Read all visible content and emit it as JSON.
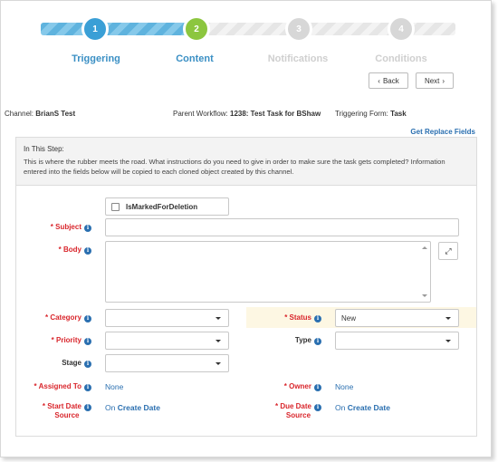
{
  "stepper": {
    "steps": [
      {
        "number": "1",
        "label": "Triggering",
        "state": "done",
        "color": "#3a9fd6",
        "label_color": "#3a8fc4"
      },
      {
        "number": "2",
        "label": "Content",
        "state": "active",
        "color": "#8cc63f",
        "label_color": "#3a8fc4"
      },
      {
        "number": "3",
        "label": "Notifications",
        "state": "pending",
        "color": "#d7d7d7",
        "label_color": "#d0d0d0"
      },
      {
        "number": "4",
        "label": "Conditions",
        "state": "pending",
        "color": "#d7d7d7",
        "label_color": "#d0d0d0"
      }
    ]
  },
  "nav": {
    "back_label": "Back",
    "next_label": "Next"
  },
  "info": {
    "channel_label": "Channel:",
    "channel_value": "BrianS Test",
    "workflow_label": "Parent Workflow:",
    "workflow_value": "1238: Test Task for BShaw",
    "form_label": "Triggering Form:",
    "form_value": "Task",
    "replace_link": "Get Replace Fields"
  },
  "panel": {
    "title": "In This Step:",
    "description": "This is where the rubber meets the road. What instructions do you need to give in order to make sure the task gets completed? Information entered into the fields below will be copied to each cloned object created by this channel."
  },
  "form": {
    "checkbox_label": "IsMarkedForDeletion",
    "subject_label": "* Subject",
    "subject_value": "",
    "body_label": "* Body",
    "body_value": "",
    "category_label": "* Category",
    "category_value": "",
    "status_label": "* Status",
    "status_value": "New",
    "priority_label": "* Priority",
    "priority_value": "",
    "type_label": "Type",
    "type_value": "",
    "stage_label": "Stage",
    "stage_value": "",
    "assigned_label": "* Assigned To",
    "assigned_value": "None",
    "owner_label": "* Owner",
    "owner_value": "None",
    "start_label_1": "* Start Date",
    "start_label_2": "Source",
    "start_prefix": "On",
    "start_value": "Create Date",
    "due_label_1": "* Due Date",
    "due_label_2": "Source",
    "due_prefix": "On",
    "due_value": "Create Date"
  },
  "icons": [
    "check-icon",
    "info-icon",
    "caret-down-icon",
    "expand-icon",
    "chevron-left-icon",
    "chevron-right-icon"
  ]
}
